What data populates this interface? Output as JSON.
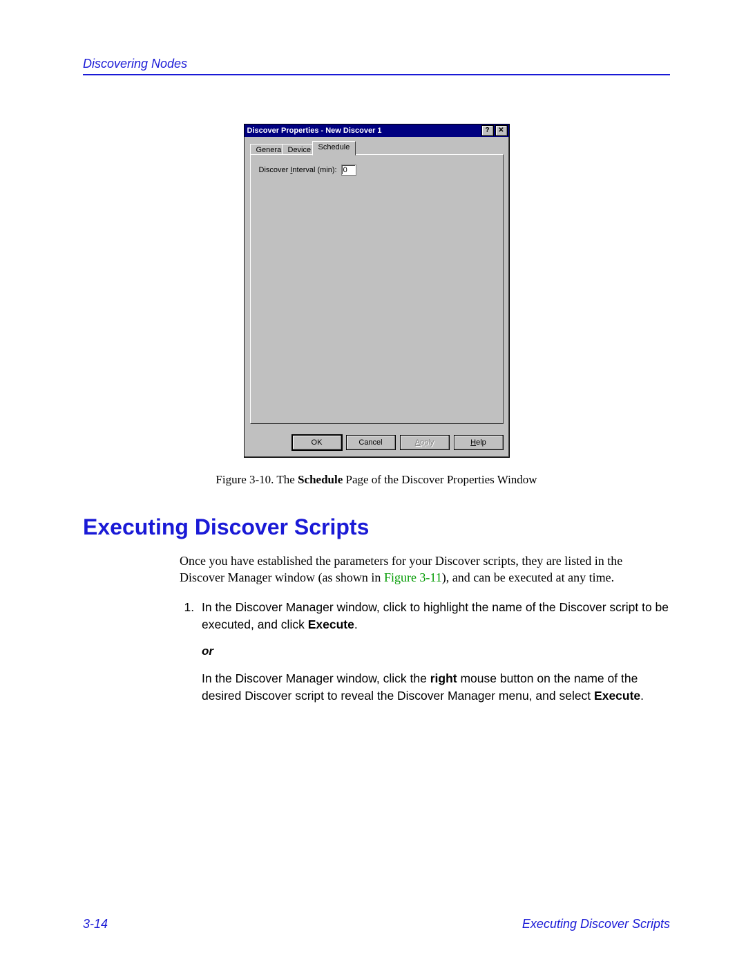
{
  "running_head": "Discovering Nodes",
  "dialog": {
    "title": "Discover Properties - New Discover 1",
    "help_btn": "?",
    "close_btn": "✕",
    "tabs": {
      "general": "General",
      "device": "Device",
      "schedule": "Schedule"
    },
    "interval_label_pre": "Discover ",
    "interval_label_ul": "I",
    "interval_label_post": "nterval (min):",
    "interval_value": "0",
    "buttons": {
      "ok": "OK",
      "cancel": "Cancel",
      "apply_ul": "A",
      "apply_rest": "pply",
      "help_ul": "H",
      "help_rest": "elp"
    }
  },
  "caption": {
    "prefix": "Figure 3-10.  The ",
    "bold": "Schedule",
    "suffix": " Page of the Discover Properties Window"
  },
  "section_heading": "Executing Discover Scripts",
  "intro_pre": "Once you have established the parameters for your Discover scripts, they are listed in the Discover Manager window (as shown in ",
  "intro_xref": "Figure 3-11",
  "intro_post": "), and can be executed at any time.",
  "step1_pre": "In the Discover Manager window, click to highlight the name of the Discover script to be executed, and click ",
  "step1_bold": "Execute",
  "step1_post": ".",
  "or_text": "or",
  "step1b_pre": "In the Discover Manager window, click the ",
  "step1b_bold1": "right",
  "step1b_mid": " mouse button on the name of the desired Discover script to reveal the Discover Manager menu, and select ",
  "step1b_bold2": "Execute",
  "step1b_post": ".",
  "footer_page": "3-14",
  "footer_section": "Executing Discover Scripts"
}
